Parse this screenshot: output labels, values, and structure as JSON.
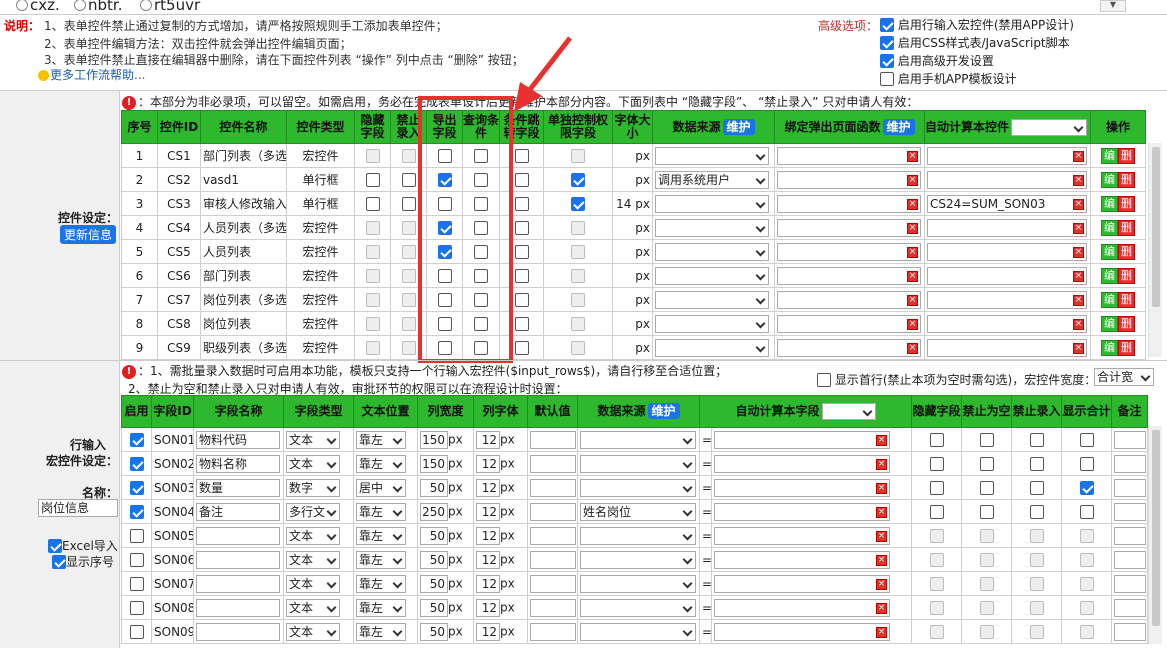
{
  "top_radios": [
    "cxz.",
    "nbtr.",
    "rt5uvr"
  ],
  "notes": {
    "label": "说明：",
    "line1": "1、表单控件禁止通过复制的方式增加，请严格按照规则手工添加表单控件；",
    "line2": "2、表单控件编辑方法：双击控件就会弹出控件编辑页面；",
    "line3": "3、表单控件禁止直接在编辑器中删除，请在下面控件列表 “操作” 列中点击 “删除” 按钮；",
    "help_link": "更多工作流帮助..."
  },
  "advanced": {
    "label": "高级选项：",
    "options": [
      {
        "label": "启用行输入宏控件(禁用APP设计)",
        "checked": true
      },
      {
        "label": "启用CSS样式表/JavaScript脚本",
        "checked": true
      },
      {
        "label": "启用高级开发设置",
        "checked": true
      },
      {
        "label": "启用手机APP模板设计",
        "checked": false
      }
    ]
  },
  "controls_section": {
    "label": "控件设定：",
    "update_button": "更新信息",
    "note": "：本部分为非必录项，可以留空。如需启用，务必在完成表单设计后更新维护本部分内容。下面列表中 “隐藏字段”、 “禁止录入” 只对申请人有效：",
    "headers": {
      "seq": "序号",
      "id": "控件ID",
      "name": "控件名称",
      "type": "控件类型",
      "hidden": "隐藏字段",
      "readonly": "禁止录入",
      "export": "导出字段",
      "query": "查询条件",
      "cond_jump": "条件跳转字段",
      "perm": "单独控制权限字段",
      "font": "字体大小",
      "datasource": "数据来源",
      "maintain": "维护",
      "bind_func": "绑定弹出页面函数",
      "autocalc": "自动计算本控件",
      "ops": "操作"
    },
    "edit_label": "编",
    "del_label": "删",
    "px": "px",
    "rows": [
      {
        "seq": "1",
        "id": "CS1",
        "name": "部门列表（多选",
        "type": "宏控件",
        "hidden": null,
        "readonly": null,
        "export": false,
        "query": false,
        "cond": false,
        "perm": null,
        "font": "",
        "ds": "",
        "calc": ""
      },
      {
        "seq": "2",
        "id": "CS2",
        "name": "vasd1",
        "type": "单行框",
        "hidden": false,
        "readonly": false,
        "export": true,
        "query": false,
        "cond": false,
        "perm": true,
        "font": "",
        "ds": "调用系统用户",
        "calc": ""
      },
      {
        "seq": "3",
        "id": "CS3",
        "name": "审核人修改输入",
        "type": "单行框",
        "hidden": false,
        "readonly": false,
        "export": false,
        "query": false,
        "cond": false,
        "perm": true,
        "font": "14",
        "ds": "",
        "calc": "CS24=SUM_SON03"
      },
      {
        "seq": "4",
        "id": "CS4",
        "name": "人员列表（多选",
        "type": "宏控件",
        "hidden": null,
        "readonly": null,
        "export": true,
        "query": false,
        "cond": false,
        "perm": null,
        "font": "",
        "ds": "",
        "calc": ""
      },
      {
        "seq": "5",
        "id": "CS5",
        "name": "人员列表",
        "type": "宏控件",
        "hidden": null,
        "readonly": null,
        "export": true,
        "query": false,
        "cond": false,
        "perm": null,
        "font": "",
        "ds": "",
        "calc": ""
      },
      {
        "seq": "6",
        "id": "CS6",
        "name": "部门列表",
        "type": "宏控件",
        "hidden": null,
        "readonly": null,
        "export": false,
        "query": false,
        "cond": false,
        "perm": null,
        "font": "",
        "ds": "",
        "calc": ""
      },
      {
        "seq": "7",
        "id": "CS7",
        "name": "岗位列表（多选",
        "type": "宏控件",
        "hidden": null,
        "readonly": null,
        "export": false,
        "query": false,
        "cond": false,
        "perm": null,
        "font": "",
        "ds": "",
        "calc": ""
      },
      {
        "seq": "8",
        "id": "CS8",
        "name": "岗位列表",
        "type": "宏控件",
        "hidden": null,
        "readonly": null,
        "export": false,
        "query": false,
        "cond": false,
        "perm": null,
        "font": "",
        "ds": "",
        "calc": ""
      },
      {
        "seq": "9",
        "id": "CS9",
        "name": "职级列表（多选",
        "type": "宏控件",
        "hidden": null,
        "readonly": null,
        "export": false,
        "query": false,
        "cond": false,
        "perm": null,
        "font": "",
        "ds": "",
        "calc": ""
      }
    ]
  },
  "rows_section": {
    "label_line1": "行输入",
    "label_line2": "宏控件设定：",
    "name_label": "名称：",
    "name_value": "岗位信息",
    "excel_import": {
      "label": "Excel导入",
      "checked": true
    },
    "show_seq": {
      "label": "显示序号",
      "checked": true
    },
    "note1": "：1、需批量录入数据时可启用本功能，模板只支持一个行输入宏控件($input_rows$)，请自行移至合适位置；",
    "note2": "2、禁止为空和禁止录入只对申请人有效，审批环节的权限可以在流程设计时设置：",
    "show_first_row": {
      "label": "显示首行(禁止本项为空时需勾选)，宏控件宽度：",
      "checked": false
    },
    "width_select": "合计宽",
    "headers": {
      "enable": "启用",
      "fid": "字段ID",
      "fname": "字段名称",
      "ftype": "字段类型",
      "align": "文本位置",
      "width": "列宽度",
      "font": "列字体",
      "default": "默认值",
      "ds": "数据来源",
      "maintain": "维护",
      "autocalc": "自动计算本字段",
      "hidden": "隐藏字段",
      "notnull": "禁止为空",
      "readonly": "禁止录入",
      "total": "显示合计",
      "remark": "备注"
    },
    "px": "px",
    "eq": "=",
    "rows": [
      {
        "enabled": true,
        "id": "SON01",
        "name": "物料代码",
        "type": "文本",
        "align": "靠左",
        "width": "150",
        "font": "12",
        "ds": "",
        "hidden": false,
        "notnull": false,
        "readonly": false,
        "total": false
      },
      {
        "enabled": true,
        "id": "SON02",
        "name": "物料名称",
        "type": "文本",
        "align": "靠左",
        "width": "150",
        "font": "12",
        "ds": "",
        "hidden": false,
        "notnull": false,
        "readonly": false,
        "total": false
      },
      {
        "enabled": true,
        "id": "SON03",
        "name": "数量",
        "type": "数字",
        "align": "居中",
        "width": "50",
        "font": "12",
        "ds": "",
        "hidden": false,
        "notnull": false,
        "readonly": false,
        "total": true
      },
      {
        "enabled": true,
        "id": "SON04",
        "name": "备注",
        "type": "多行文",
        "align": "靠左",
        "width": "250",
        "font": "12",
        "ds": "姓名岗位",
        "hidden": false,
        "notnull": false,
        "readonly": false,
        "total": false
      },
      {
        "enabled": false,
        "id": "SON05",
        "name": "",
        "type": "文本",
        "align": "靠左",
        "width": "50",
        "font": "12",
        "ds": "",
        "hidden": null,
        "notnull": null,
        "readonly": null,
        "total": null
      },
      {
        "enabled": false,
        "id": "SON06",
        "name": "",
        "type": "文本",
        "align": "靠左",
        "width": "50",
        "font": "12",
        "ds": "",
        "hidden": null,
        "notnull": null,
        "readonly": null,
        "total": null
      },
      {
        "enabled": false,
        "id": "SON07",
        "name": "",
        "type": "文本",
        "align": "靠左",
        "width": "50",
        "font": "12",
        "ds": "",
        "hidden": null,
        "notnull": null,
        "readonly": null,
        "total": null
      },
      {
        "enabled": false,
        "id": "SON08",
        "name": "",
        "type": "文本",
        "align": "靠左",
        "width": "50",
        "font": "12",
        "ds": "",
        "hidden": null,
        "notnull": null,
        "readonly": null,
        "total": null
      },
      {
        "enabled": false,
        "id": "SON09",
        "name": "",
        "type": "文本",
        "align": "靠左",
        "width": "50",
        "font": "12",
        "ds": "",
        "hidden": null,
        "notnull": null,
        "readonly": null,
        "total": null
      }
    ]
  },
  "colors": {
    "header_green": "#2eb82e",
    "accent_blue": "#1a73e8",
    "delete_red": "#e53030",
    "highlight_red": "#e8312f"
  }
}
